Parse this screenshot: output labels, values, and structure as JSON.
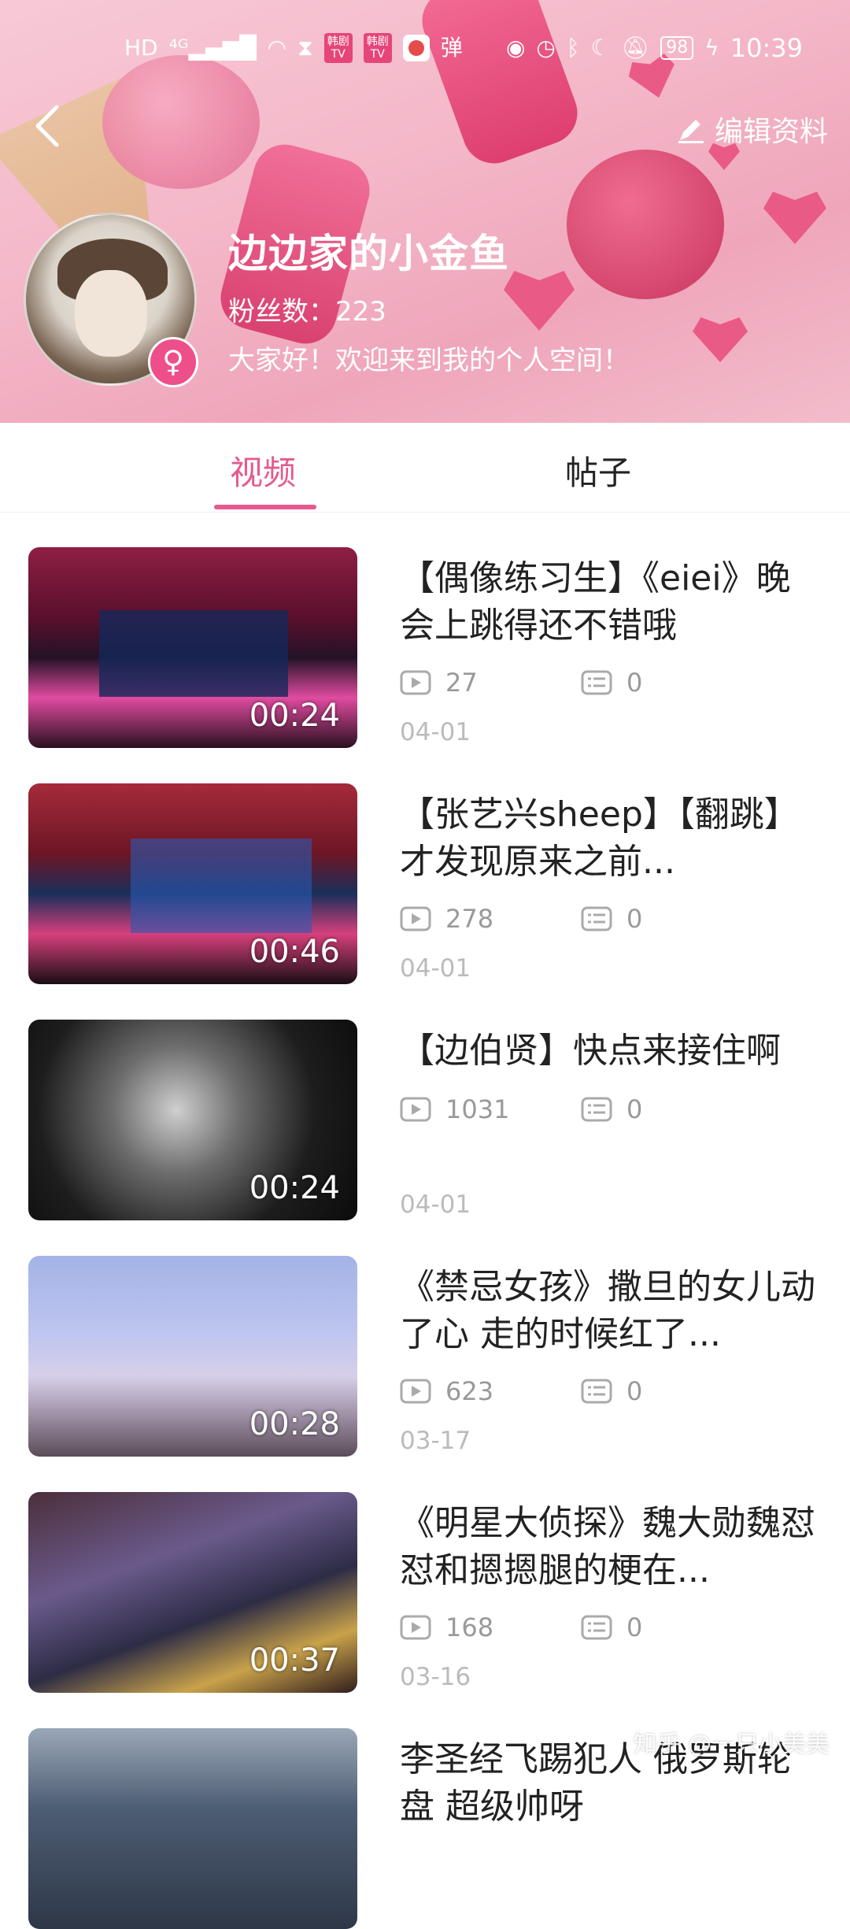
{
  "status_bar": {
    "left_icons": [
      "hd-icon",
      "signal-4g-icon",
      "wifi-icon",
      "hourglass-icon",
      "tv-app-icon",
      "tv-app-icon",
      "app-icon"
    ],
    "tv_badge": "韩剧\nTV",
    "dan": "弹",
    "battery": "98",
    "time": "10:39"
  },
  "header": {
    "edit_label": "编辑资料",
    "user_name": "边边家的小金鱼",
    "fans": "粉丝数：223",
    "intro": "大家好！欢迎来到我的个人空间！",
    "gender_symbol": "♀"
  },
  "tabs": [
    {
      "label": "视频",
      "active": true
    },
    {
      "label": "帖子",
      "active": false
    }
  ],
  "videos": [
    {
      "title": "【偶像练习生】《eiei》晚会上跳得还不错哦",
      "duration": "00:24",
      "plays": "27",
      "comments": "0",
      "date": "04-01"
    },
    {
      "title": "【张艺兴sheep】【翻跳】才发现原来之前...",
      "duration": "00:46",
      "plays": "278",
      "comments": "0",
      "date": "04-01"
    },
    {
      "title": "【边伯贤】快点来接住啊",
      "duration": "00:24",
      "plays": "1031",
      "comments": "0",
      "date": "04-01"
    },
    {
      "title": "《禁忌女孩》撒旦的女儿动了心 走的时候红了...",
      "duration": "00:28",
      "plays": "623",
      "comments": "0",
      "date": "03-17"
    },
    {
      "title": "《明星大侦探》魏大勋魏怼怼和摁摁腿的梗在...",
      "duration": "00:37",
      "plays": "168",
      "comments": "0",
      "date": "03-16"
    },
    {
      "title": "李圣经飞踢犯人 俄罗斯轮盘 超级帅呀",
      "duration": "",
      "plays": "",
      "comments": "",
      "date": ""
    }
  ],
  "watermark": "知乎 @一只小美美",
  "colors": {
    "accent": "#e45a8f",
    "badge": "#ec4f8a"
  }
}
